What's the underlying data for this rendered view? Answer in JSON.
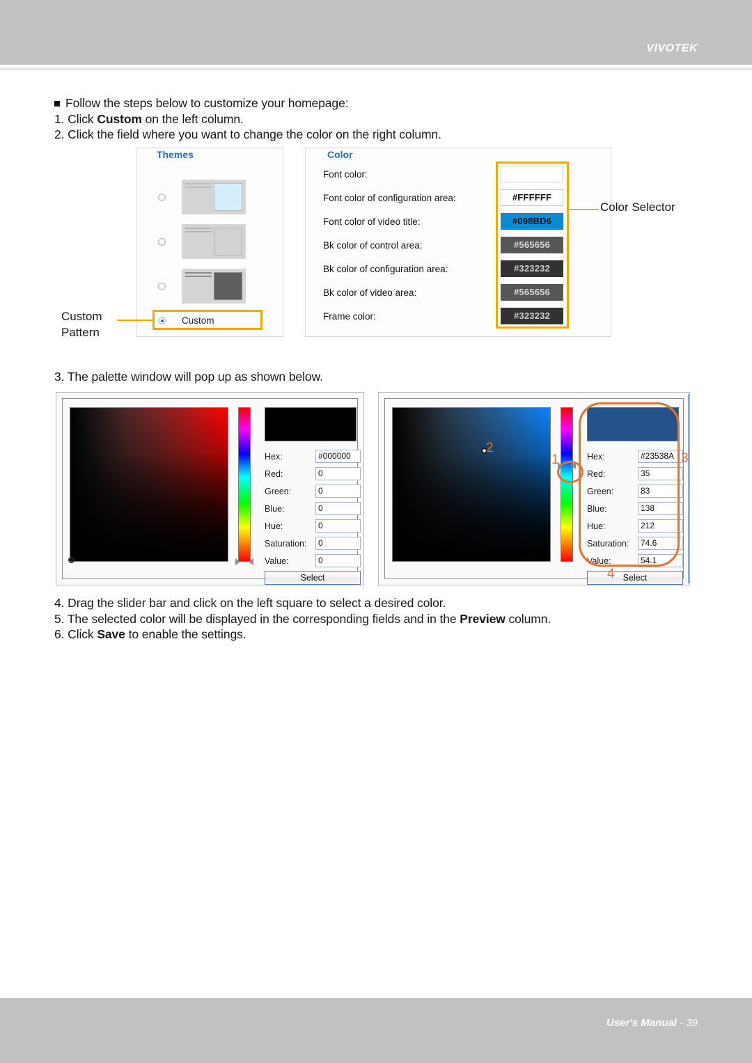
{
  "header": {
    "brand": "VIVOTEK"
  },
  "footer": {
    "label": "User's Manual",
    "separator": " - ",
    "page": "39"
  },
  "body_copy": {
    "bullet": "Follow the steps below to customize your homepage:",
    "step1_a": "1. Click ",
    "step1_b": "Custom",
    "step1_c": " on the left column.",
    "step2": "2. Click the field where you want to change the color on the right column.",
    "step3": "3. The palette window will pop up as shown below.",
    "step4": "4. Drag the slider bar and click on the left square to select a desired color.",
    "step5_a": "5. The selected color will be displayed in the corresponding fields and in the ",
    "step5_b": "Preview",
    "step5_c": " column.",
    "step6_a": "6. Click ",
    "step6_b": "Save",
    "step6_c": " to enable the settings."
  },
  "callouts": {
    "custom_pattern_line1": "Custom",
    "custom_pattern_line2": "Pattern",
    "color_selector": "Color Selector",
    "highlight_color": "#f5a800"
  },
  "themes_panel": {
    "legend": "Themes",
    "options": [
      {
        "id": "theme-blue",
        "selected": false
      },
      {
        "id": "theme-light",
        "selected": false
      },
      {
        "id": "theme-dark",
        "selected": false
      }
    ],
    "custom": {
      "label": "Custom",
      "selected": true
    }
  },
  "color_panel": {
    "legend": "Color",
    "rows": [
      {
        "label": "Font color:",
        "value": "",
        "swatch_bg": "#ffffff",
        "text_color": "#111111"
      },
      {
        "label": "Font color of configuration area:",
        "value": "#FFFFFF",
        "swatch_bg": "#ffffff",
        "text_color": "#111111"
      },
      {
        "label": "Font color of video title:",
        "value": "#098BD6",
        "swatch_bg": "#098bd6",
        "text_color": "#111111"
      },
      {
        "label": "Bk color of control area:",
        "value": "#565656",
        "swatch_bg": "#565656",
        "text_color": "#d9d9d9"
      },
      {
        "label": "Bk color of configuration area:",
        "value": "#323232",
        "swatch_bg": "#323232",
        "text_color": "#cfcfcf"
      },
      {
        "label": "Bk color of video area:",
        "value": "#565656",
        "swatch_bg": "#565656",
        "text_color": "#d9d9d9"
      },
      {
        "label": "Frame color:",
        "value": "#323232",
        "swatch_bg": "#323232",
        "text_color": "#cfcfcf"
      }
    ]
  },
  "palette_left": {
    "preview_color": "#000000",
    "select_label": "Select",
    "fields": [
      {
        "label": "Hex:",
        "value": "#000000"
      },
      {
        "label": "Red:",
        "value": "0"
      },
      {
        "label": "Green:",
        "value": "0"
      },
      {
        "label": "Blue:",
        "value": "0"
      },
      {
        "label": "Hue:",
        "value": "0"
      },
      {
        "label": "Saturation:",
        "value": "0"
      },
      {
        "label": "Value:",
        "value": "0"
      }
    ]
  },
  "palette_right": {
    "preview_color": "#23538A",
    "select_label": "Select",
    "fields": [
      {
        "label": "Hex:",
        "value": "#23538A"
      },
      {
        "label": "Red:",
        "value": "35"
      },
      {
        "label": "Green:",
        "value": "83"
      },
      {
        "label": "Blue:",
        "value": "138"
      },
      {
        "label": "Hue:",
        "value": "212"
      },
      {
        "label": "Saturation:",
        "value": "74.6"
      },
      {
        "label": "Value:",
        "value": "54.1"
      }
    ],
    "annotations": [
      {
        "id": "anno-1",
        "text": "1"
      },
      {
        "id": "anno-2",
        "text": "2"
      },
      {
        "id": "anno-3",
        "text": "3"
      },
      {
        "id": "anno-4",
        "text": "4"
      }
    ],
    "annotation_color": "#e8722a"
  }
}
